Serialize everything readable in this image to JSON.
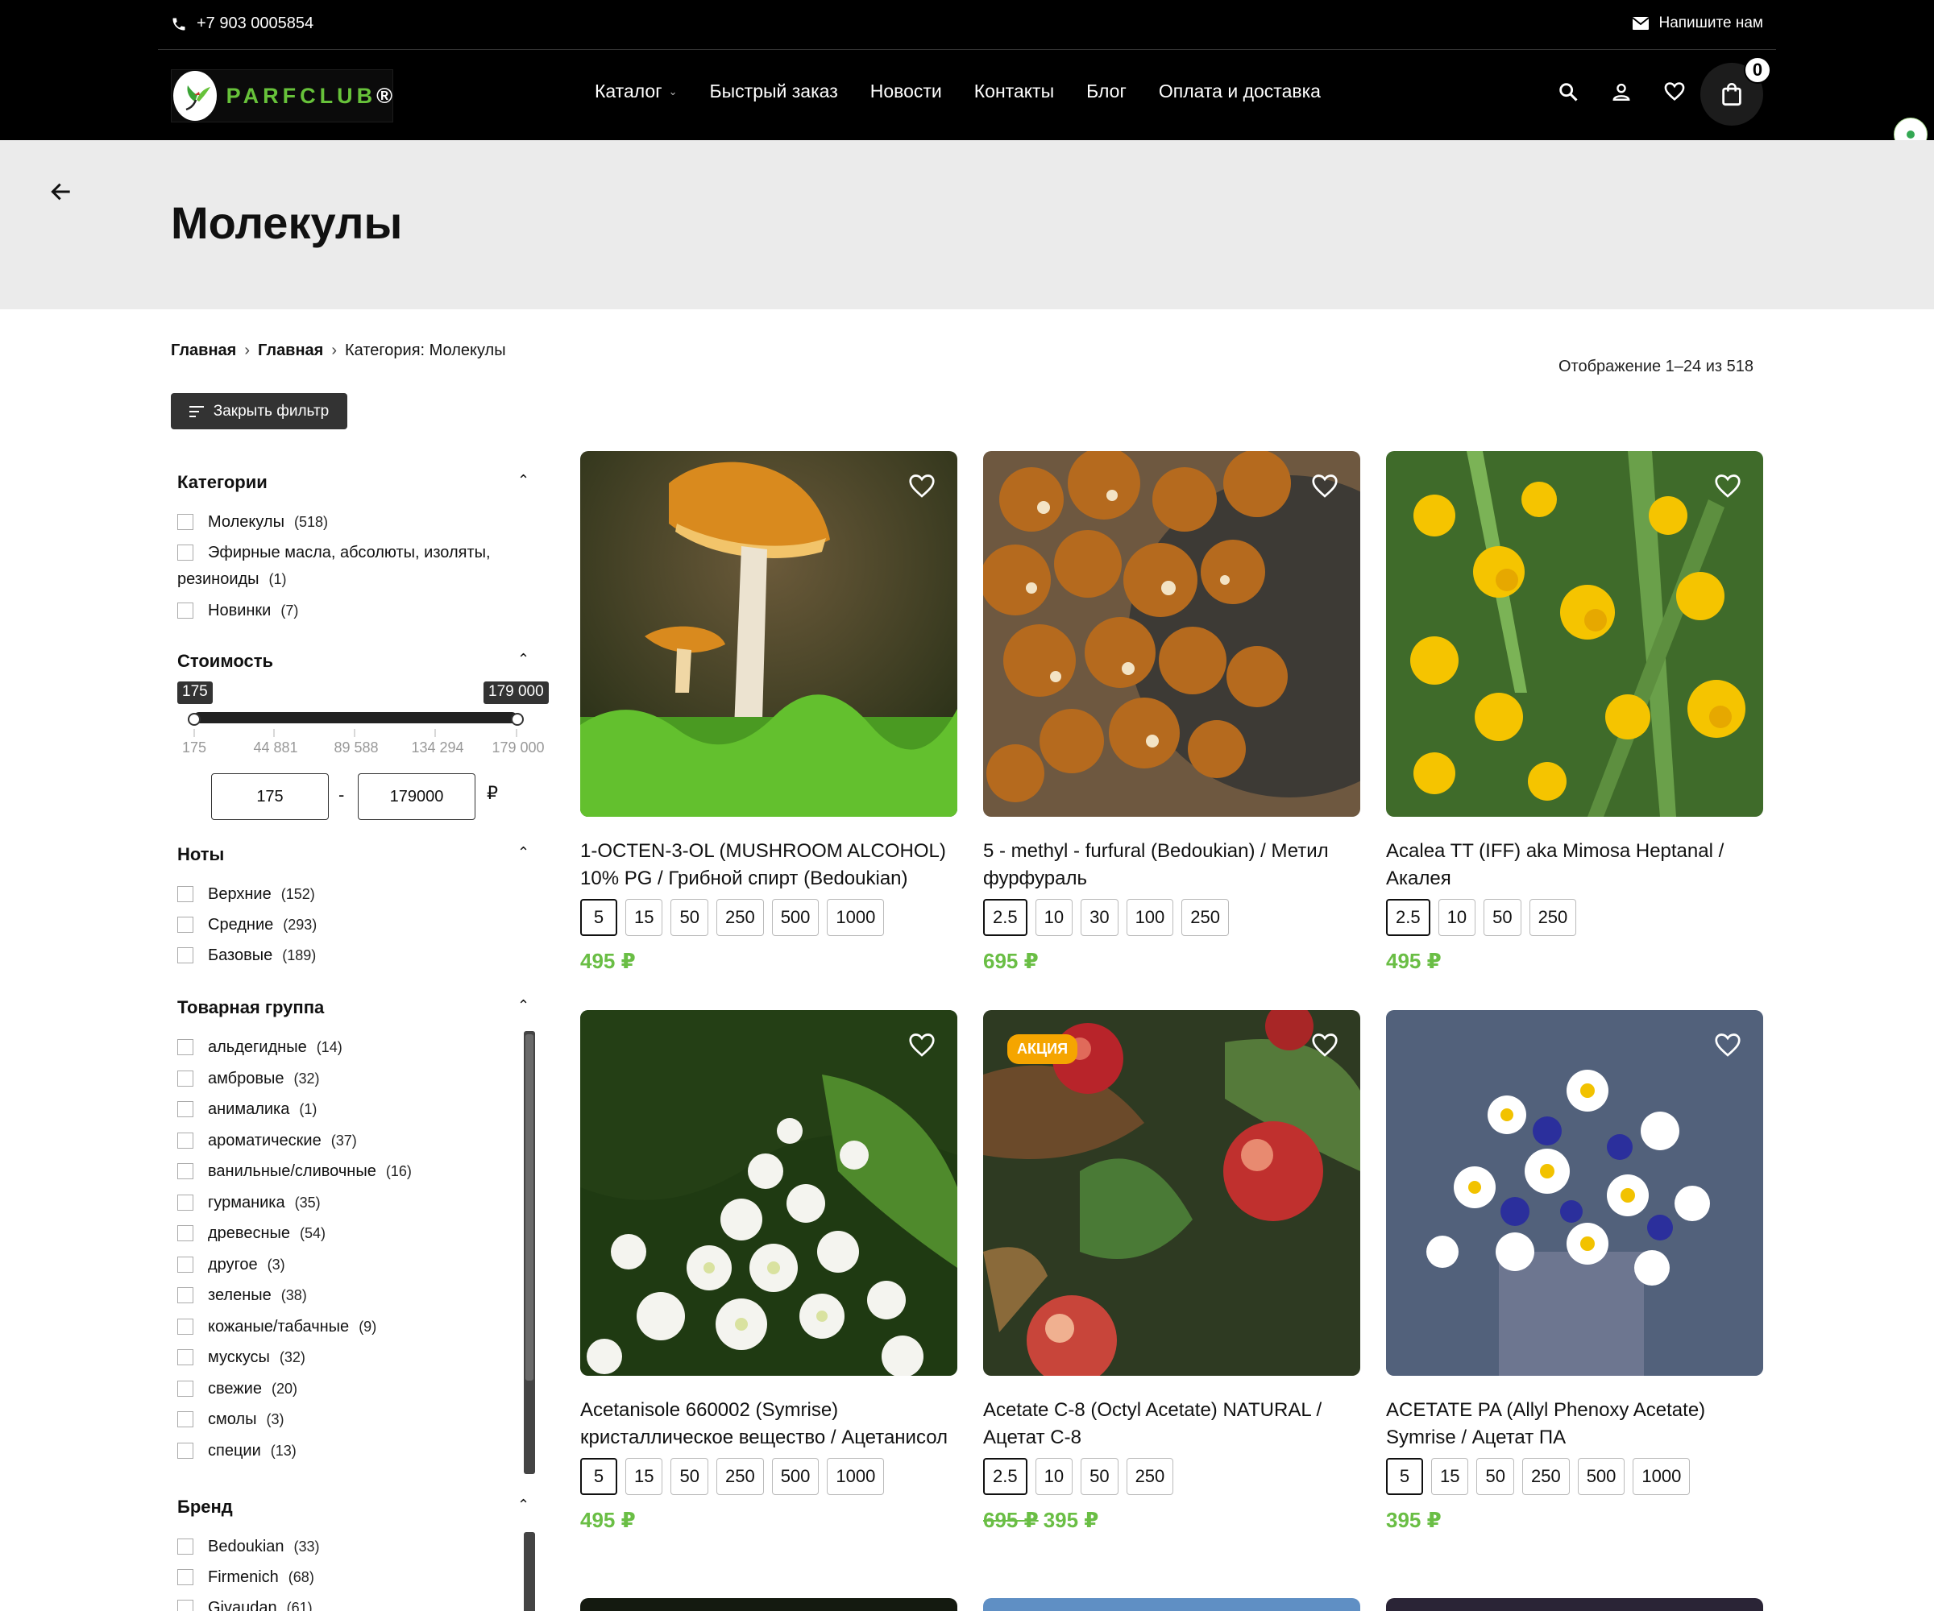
{
  "header": {
    "phone": "+7 903 0005854",
    "write_us": "Напишите нам",
    "logo_text": "PARFCLUB",
    "logo_reg": "®",
    "nav": [
      "Каталог",
      "Быстрый заказ",
      "Новости",
      "Контакты",
      "Блог",
      "Оплата и доставка"
    ],
    "cart_count": "0",
    "icons": [
      "search-icon",
      "user-icon",
      "heart-icon",
      "cart-icon"
    ]
  },
  "page": {
    "title": "Молекулы",
    "breadcrumb": [
      "Главная",
      "Главная",
      "Категория: Молекулы"
    ],
    "result_count": "Отображение 1–24 из 518",
    "filter_toggle": "Закрыть фильтр"
  },
  "filters": {
    "categories": {
      "title": "Категории",
      "items": [
        {
          "label": "Молекулы",
          "count": "(518)"
        },
        {
          "label": "Эфирные масла, абсолюты, изоляты,",
          "label2": "резиноиды",
          "count": "(1)"
        },
        {
          "label": "Новинки",
          "count": "(7)"
        }
      ]
    },
    "price": {
      "title": "Стоимость",
      "min_tag": "175",
      "max_tag": "179 000",
      "ticks": [
        "175",
        "44 881",
        "89 588",
        "134 294",
        "179 000"
      ],
      "min_value": "175",
      "max_value": "179000",
      "dash": "-",
      "currency": "₽"
    },
    "notes": {
      "title": "Ноты",
      "items": [
        {
          "label": "Верхние",
          "count": "(152)"
        },
        {
          "label": "Средние",
          "count": "(293)"
        },
        {
          "label": "Базовые",
          "count": "(189)"
        }
      ]
    },
    "group": {
      "title": "Товарная группа",
      "items": [
        {
          "label": "альдегидные",
          "count": "(14)"
        },
        {
          "label": "амбровые",
          "count": "(32)"
        },
        {
          "label": "анималика",
          "count": "(1)"
        },
        {
          "label": "ароматические",
          "count": "(37)"
        },
        {
          "label": "ванильные/сливочные",
          "count": "(16)"
        },
        {
          "label": "гурманика",
          "count": "(35)"
        },
        {
          "label": "древесные",
          "count": "(54)"
        },
        {
          "label": "другое",
          "count": "(3)"
        },
        {
          "label": "зеленые",
          "count": "(38)"
        },
        {
          "label": "кожаные/табачные",
          "count": "(9)"
        },
        {
          "label": "мускусы",
          "count": "(32)"
        },
        {
          "label": "свежие",
          "count": "(20)"
        },
        {
          "label": "смолы",
          "count": "(3)"
        },
        {
          "label": "специи",
          "count": "(13)"
        }
      ]
    },
    "brand": {
      "title": "Бренд",
      "items": [
        {
          "label": "Bedoukian",
          "count": "(33)"
        },
        {
          "label": "Firmenich",
          "count": "(68)"
        },
        {
          "label": "Givaudan",
          "count": "(61)"
        }
      ]
    }
  },
  "products": [
    {
      "title": "1-OCTEN-3-OL (MUSHROOM ALCOHOL) 10% PG / Грибной спирт (Bedoukian)",
      "sizes": [
        "5",
        "15",
        "50",
        "250",
        "500",
        "1000"
      ],
      "selected": "5",
      "price": "495 ₽",
      "old_price": "",
      "badge": ""
    },
    {
      "title": "5 - methyl - furfural (Bedoukian) / Метил фурфураль",
      "sizes": [
        "2.5",
        "10",
        "30",
        "100",
        "250"
      ],
      "selected": "2.5",
      "price": "695 ₽",
      "old_price": "",
      "badge": ""
    },
    {
      "title": "Acalea TT (IFF) aka Mimosa Heptanal / Акалея",
      "sizes": [
        "2.5",
        "10",
        "50",
        "250"
      ],
      "selected": "2.5",
      "price": "495 ₽",
      "old_price": "",
      "badge": ""
    },
    {
      "title": "Acetanisole 660002 (Symrise) кристаллическое вещество / Ацетанисол",
      "sizes": [
        "5",
        "15",
        "50",
        "250",
        "500",
        "1000"
      ],
      "selected": "5",
      "price": "495 ₽",
      "old_price": "",
      "badge": ""
    },
    {
      "title": "Acetate C-8 (Octyl Acetate) NATURAL / Ацетат С-8",
      "sizes": [
        "2.5",
        "10",
        "50",
        "250"
      ],
      "selected": "2.5",
      "price": "395 ₽",
      "old_price": "695 ₽",
      "badge": "АКЦИЯ"
    },
    {
      "title": "ACETATE PA (Allyl Phenoxy Acetate) Symrise / Ацетат ПА",
      "sizes": [
        "5",
        "15",
        "50",
        "250",
        "500",
        "1000"
      ],
      "selected": "5",
      "price": "395 ₽",
      "old_price": "",
      "badge": ""
    }
  ]
}
